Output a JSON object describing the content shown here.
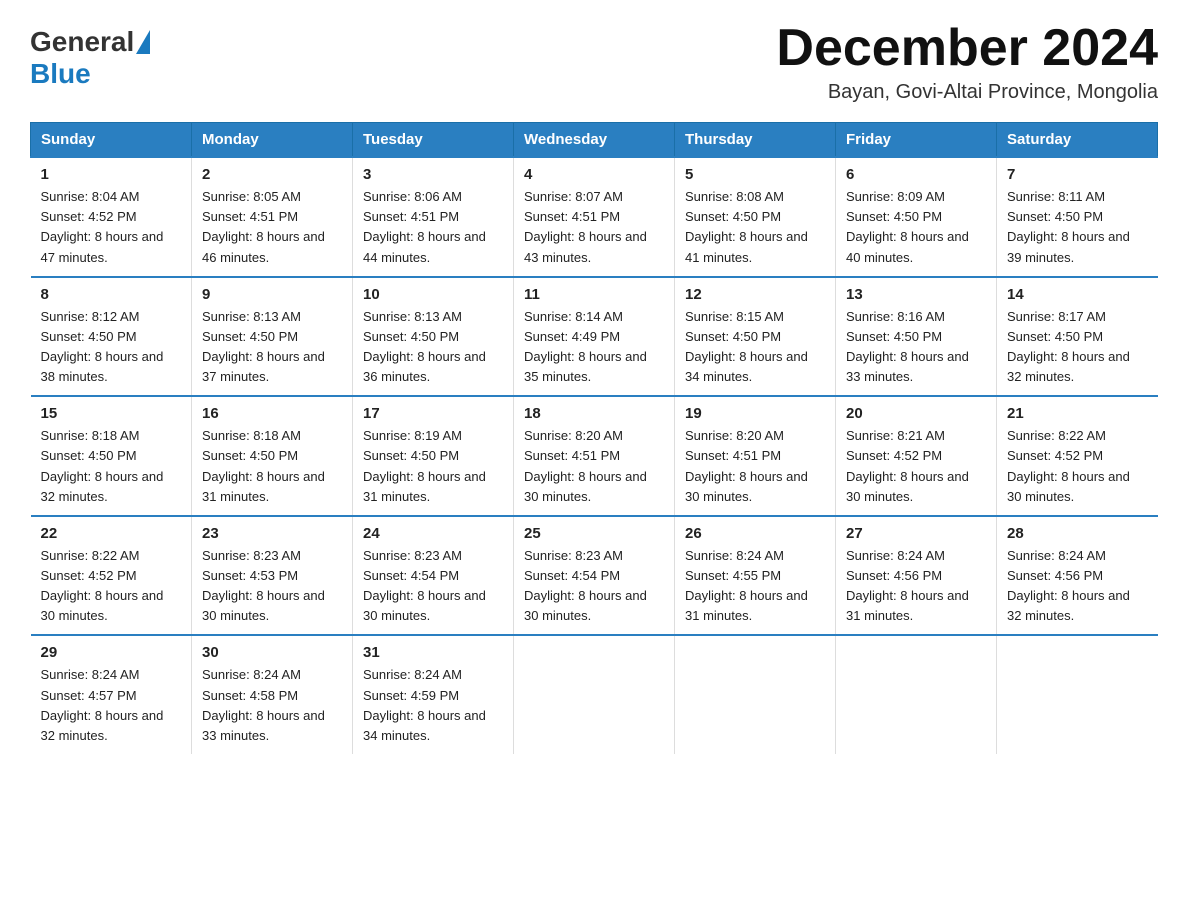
{
  "logo": {
    "general": "General",
    "blue": "Blue"
  },
  "title": "December 2024",
  "subtitle": "Bayan, Govi-Altai Province, Mongolia",
  "headers": [
    "Sunday",
    "Monday",
    "Tuesday",
    "Wednesday",
    "Thursday",
    "Friday",
    "Saturday"
  ],
  "weeks": [
    [
      {
        "day": "1",
        "sunrise": "8:04 AM",
        "sunset": "4:52 PM",
        "daylight": "8 hours and 47 minutes."
      },
      {
        "day": "2",
        "sunrise": "8:05 AM",
        "sunset": "4:51 PM",
        "daylight": "8 hours and 46 minutes."
      },
      {
        "day": "3",
        "sunrise": "8:06 AM",
        "sunset": "4:51 PM",
        "daylight": "8 hours and 44 minutes."
      },
      {
        "day": "4",
        "sunrise": "8:07 AM",
        "sunset": "4:51 PM",
        "daylight": "8 hours and 43 minutes."
      },
      {
        "day": "5",
        "sunrise": "8:08 AM",
        "sunset": "4:50 PM",
        "daylight": "8 hours and 41 minutes."
      },
      {
        "day": "6",
        "sunrise": "8:09 AM",
        "sunset": "4:50 PM",
        "daylight": "8 hours and 40 minutes."
      },
      {
        "day": "7",
        "sunrise": "8:11 AM",
        "sunset": "4:50 PM",
        "daylight": "8 hours and 39 minutes."
      }
    ],
    [
      {
        "day": "8",
        "sunrise": "8:12 AM",
        "sunset": "4:50 PM",
        "daylight": "8 hours and 38 minutes."
      },
      {
        "day": "9",
        "sunrise": "8:13 AM",
        "sunset": "4:50 PM",
        "daylight": "8 hours and 37 minutes."
      },
      {
        "day": "10",
        "sunrise": "8:13 AM",
        "sunset": "4:50 PM",
        "daylight": "8 hours and 36 minutes."
      },
      {
        "day": "11",
        "sunrise": "8:14 AM",
        "sunset": "4:49 PM",
        "daylight": "8 hours and 35 minutes."
      },
      {
        "day": "12",
        "sunrise": "8:15 AM",
        "sunset": "4:50 PM",
        "daylight": "8 hours and 34 minutes."
      },
      {
        "day": "13",
        "sunrise": "8:16 AM",
        "sunset": "4:50 PM",
        "daylight": "8 hours and 33 minutes."
      },
      {
        "day": "14",
        "sunrise": "8:17 AM",
        "sunset": "4:50 PM",
        "daylight": "8 hours and 32 minutes."
      }
    ],
    [
      {
        "day": "15",
        "sunrise": "8:18 AM",
        "sunset": "4:50 PM",
        "daylight": "8 hours and 32 minutes."
      },
      {
        "day": "16",
        "sunrise": "8:18 AM",
        "sunset": "4:50 PM",
        "daylight": "8 hours and 31 minutes."
      },
      {
        "day": "17",
        "sunrise": "8:19 AM",
        "sunset": "4:50 PM",
        "daylight": "8 hours and 31 minutes."
      },
      {
        "day": "18",
        "sunrise": "8:20 AM",
        "sunset": "4:51 PM",
        "daylight": "8 hours and 30 minutes."
      },
      {
        "day": "19",
        "sunrise": "8:20 AM",
        "sunset": "4:51 PM",
        "daylight": "8 hours and 30 minutes."
      },
      {
        "day": "20",
        "sunrise": "8:21 AM",
        "sunset": "4:52 PM",
        "daylight": "8 hours and 30 minutes."
      },
      {
        "day": "21",
        "sunrise": "8:22 AM",
        "sunset": "4:52 PM",
        "daylight": "8 hours and 30 minutes."
      }
    ],
    [
      {
        "day": "22",
        "sunrise": "8:22 AM",
        "sunset": "4:52 PM",
        "daylight": "8 hours and 30 minutes."
      },
      {
        "day": "23",
        "sunrise": "8:23 AM",
        "sunset": "4:53 PM",
        "daylight": "8 hours and 30 minutes."
      },
      {
        "day": "24",
        "sunrise": "8:23 AM",
        "sunset": "4:54 PM",
        "daylight": "8 hours and 30 minutes."
      },
      {
        "day": "25",
        "sunrise": "8:23 AM",
        "sunset": "4:54 PM",
        "daylight": "8 hours and 30 minutes."
      },
      {
        "day": "26",
        "sunrise": "8:24 AM",
        "sunset": "4:55 PM",
        "daylight": "8 hours and 31 minutes."
      },
      {
        "day": "27",
        "sunrise": "8:24 AM",
        "sunset": "4:56 PM",
        "daylight": "8 hours and 31 minutes."
      },
      {
        "day": "28",
        "sunrise": "8:24 AM",
        "sunset": "4:56 PM",
        "daylight": "8 hours and 32 minutes."
      }
    ],
    [
      {
        "day": "29",
        "sunrise": "8:24 AM",
        "sunset": "4:57 PM",
        "daylight": "8 hours and 32 minutes."
      },
      {
        "day": "30",
        "sunrise": "8:24 AM",
        "sunset": "4:58 PM",
        "daylight": "8 hours and 33 minutes."
      },
      {
        "day": "31",
        "sunrise": "8:24 AM",
        "sunset": "4:59 PM",
        "daylight": "8 hours and 34 minutes."
      },
      null,
      null,
      null,
      null
    ]
  ]
}
